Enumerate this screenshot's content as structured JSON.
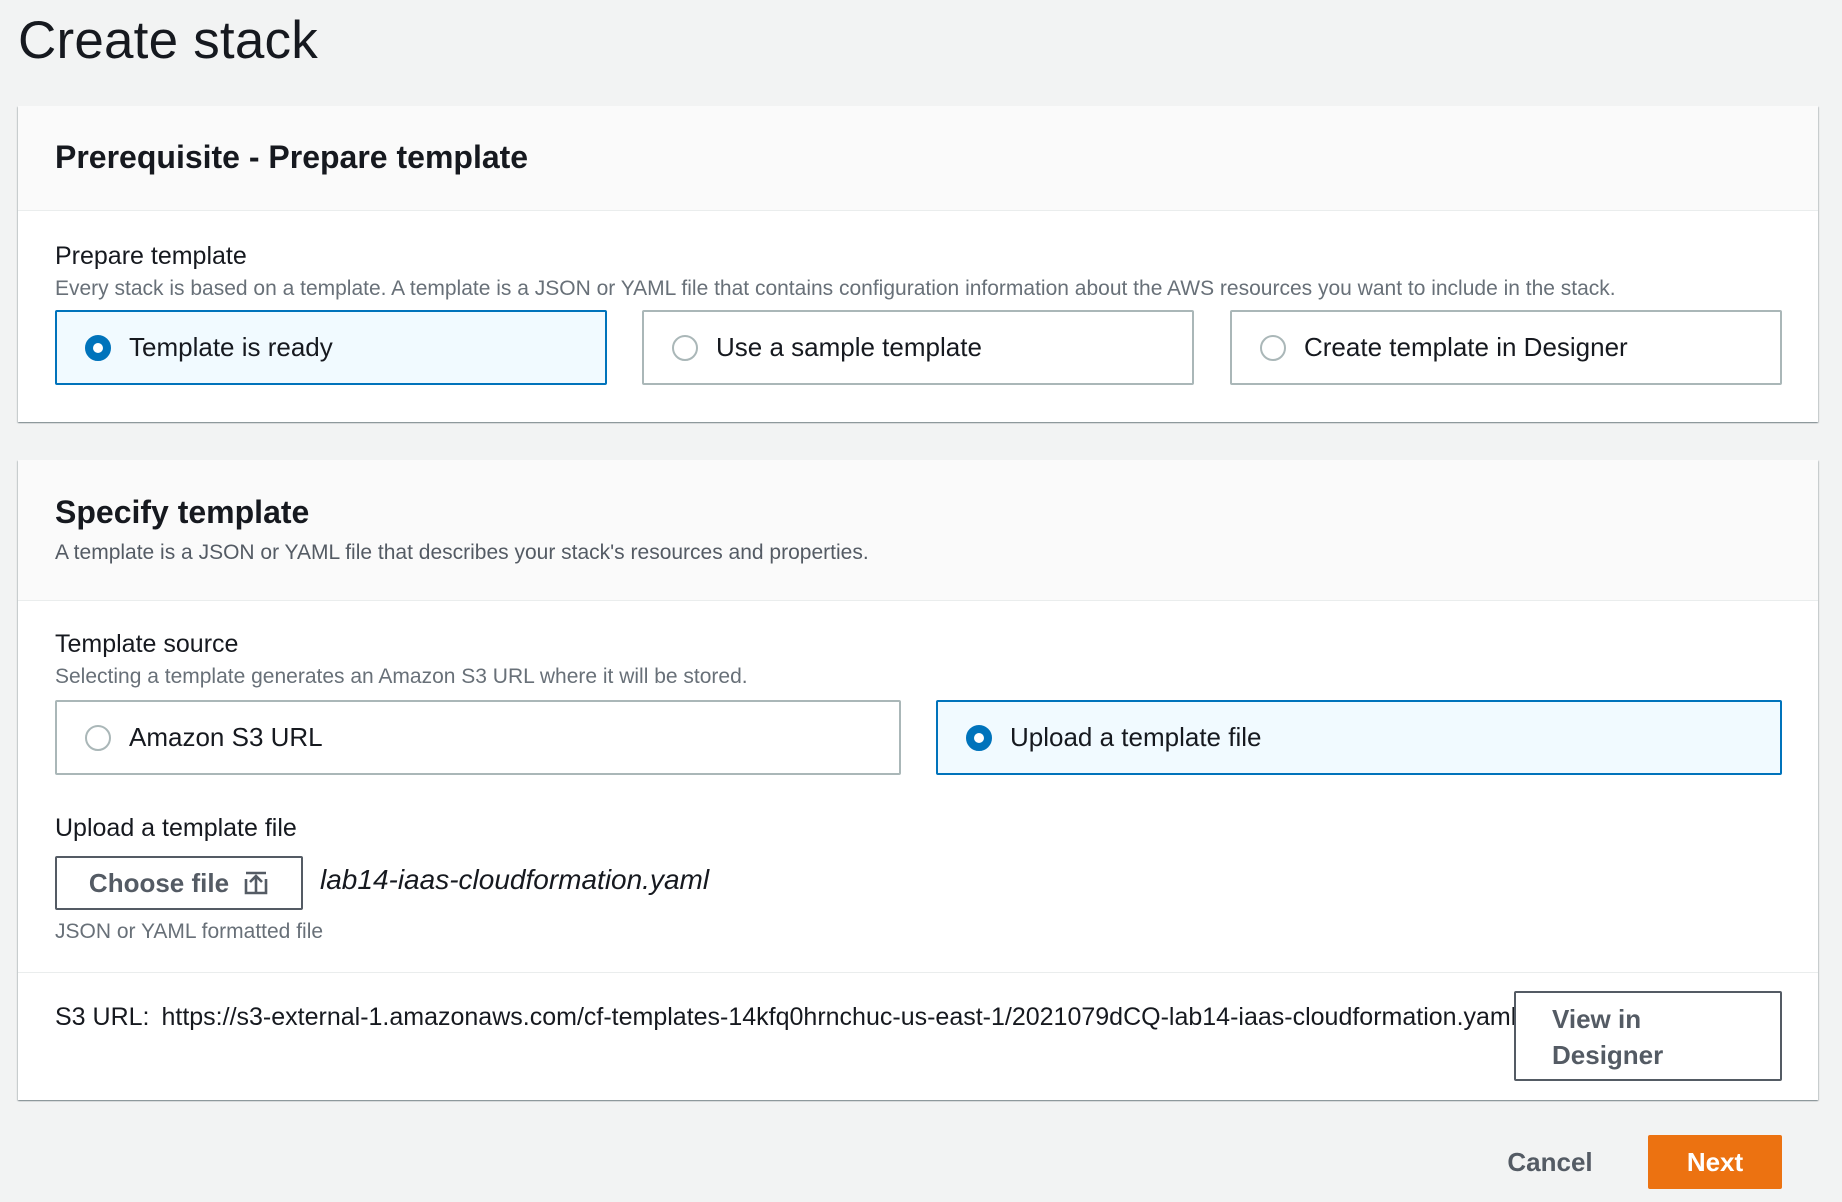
{
  "page_title": "Create stack",
  "prerequisite": {
    "heading": "Prerequisite - Prepare template",
    "field_label": "Prepare template",
    "field_desc": "Every stack is based on a template. A template is a JSON or YAML file that contains configuration information about the AWS resources you want to include in the stack.",
    "options": [
      {
        "label": "Template is ready",
        "selected": true
      },
      {
        "label": "Use a sample template",
        "selected": false
      },
      {
        "label": "Create template in Designer",
        "selected": false
      }
    ]
  },
  "specify": {
    "heading": "Specify template",
    "subheading": "A template is a JSON or YAML file that describes your stack's resources and properties.",
    "source_label": "Template source",
    "source_desc": "Selecting a template generates an Amazon S3 URL where it will be stored.",
    "source_options": [
      {
        "label": "Amazon S3 URL",
        "selected": false
      },
      {
        "label": "Upload a template file",
        "selected": true
      }
    ],
    "upload_label": "Upload a template file",
    "choose_file_label": "Choose file",
    "file_name": "lab14-iaas-cloudformation.yaml",
    "upload_hint": "JSON or YAML formatted file",
    "s3_url_label": "S3 URL:",
    "s3_url": "https://s3-external-1.amazonaws.com/cf-templates-14kfq0hrnchuc-us-east-1/2021079dCQ-lab14-iaas-cloudformation.yaml",
    "view_designer_label": "View in Designer"
  },
  "footer": {
    "cancel_label": "Cancel",
    "next_label": "Next"
  },
  "colors": {
    "selected_border": "#0073bb",
    "selected_bg": "#f1faff",
    "primary_button": "#ec7211"
  },
  "icons": {
    "upload": "upload-icon"
  }
}
